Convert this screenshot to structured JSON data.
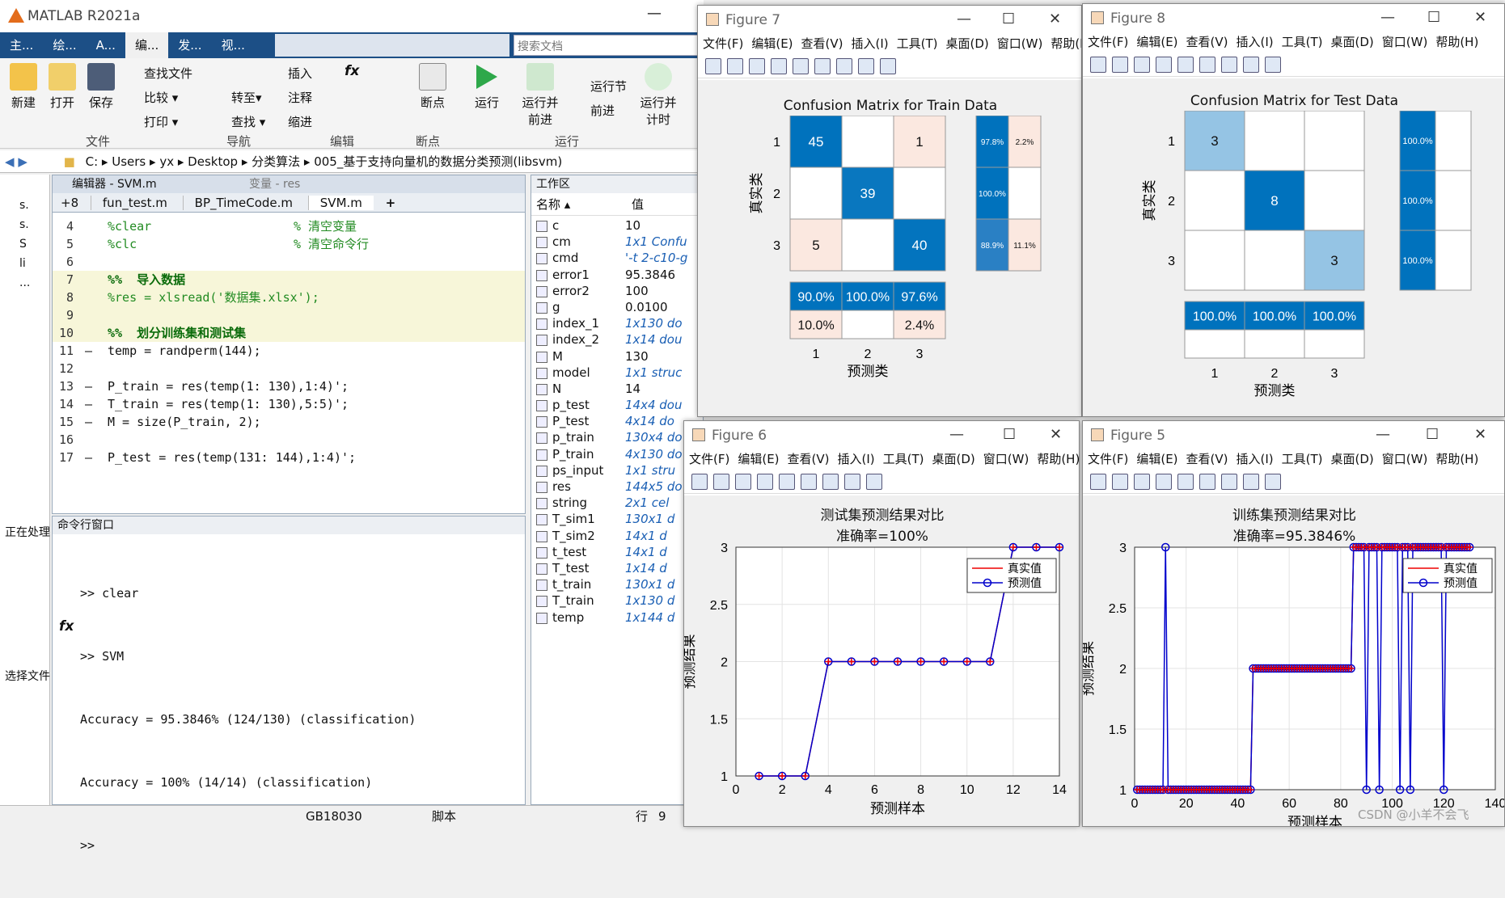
{
  "app": {
    "title": "MATLAB R2021a",
    "tabs": [
      "主...",
      "绘...",
      "A...",
      "编...",
      "发...",
      "视..."
    ],
    "search_placeholder": "搜索文档"
  },
  "ribbon": {
    "file_group": {
      "new": "新建",
      "open": "打开",
      "save": "保存",
      "find_files": "查找文件",
      "compare": "比较 ▾",
      "print": "打印 ▾",
      "label": "文件"
    },
    "nav_group": {
      "goto": "转至▾",
      "find": "查找 ▾",
      "label": "导航"
    },
    "edit_group": {
      "insert": "插入",
      "comment": "注释",
      "indent": "缩进",
      "fx": "fx",
      "label": "编辑"
    },
    "breakpoints": {
      "label": "断点",
      "btn": "断点"
    },
    "run_group": {
      "run": "运行",
      "run_advance": "运行并\n前进",
      "run_section": "运行节",
      "advance": "前进",
      "run_time": "运行并\n计时",
      "label": "运行"
    }
  },
  "breadcrumb": [
    "C:",
    "Users",
    "yx",
    "Desktop",
    "分类算法",
    "005_基于支持向量机的数据分类预测(libsvm)"
  ],
  "editor": {
    "title": "编辑器 - SVM.m",
    "var_title": "变量 - res",
    "tabs": [
      "+8",
      "fun_test.m",
      "BP_TimeCode.m",
      "SVM.m",
      "+"
    ],
    "lines": [
      {
        "n": "4",
        "dash": "",
        "code": "%clear",
        "comment": "% 清空变量",
        "type": "cm"
      },
      {
        "n": "5",
        "dash": "",
        "code": "%clc",
        "comment": "% 清空命令行",
        "type": "cm"
      },
      {
        "n": "6",
        "dash": "",
        "code": "",
        "comment": "",
        "type": "cm"
      },
      {
        "n": "7",
        "dash": "",
        "code": "%%  导入数据",
        "comment": "",
        "type": "sec"
      },
      {
        "n": "8",
        "dash": "",
        "code": "%res = xlsread('数据集.xlsx');",
        "comment": "",
        "type": "cm"
      },
      {
        "n": "9",
        "dash": "",
        "code": "",
        "comment": "",
        "type": "cm"
      },
      {
        "n": "10",
        "dash": "",
        "code": "%%  划分训练集和测试集",
        "comment": "",
        "type": "sec"
      },
      {
        "n": "11",
        "dash": "—",
        "code": "temp = randperm(144);",
        "comment": "",
        "type": "code"
      },
      {
        "n": "12",
        "dash": "",
        "code": "",
        "comment": "",
        "type": "code"
      },
      {
        "n": "13",
        "dash": "—",
        "code": "P_train = res(temp(1: 130),1:4)';",
        "comment": "",
        "type": "code"
      },
      {
        "n": "14",
        "dash": "—",
        "code": "T_train = res(temp(1: 130),5:5)';",
        "comment": "",
        "type": "code"
      },
      {
        "n": "15",
        "dash": "—",
        "code": "M = size(P_train, 2);",
        "comment": "",
        "type": "code"
      },
      {
        "n": "16",
        "dash": "",
        "code": "",
        "comment": "",
        "type": "code"
      },
      {
        "n": "17",
        "dash": "—",
        "code": "P_test = res(temp(131: 144),1:4)';",
        "comment": "",
        "type": "code"
      }
    ]
  },
  "left_panel": {
    "label1": "正在处理",
    "label2": "选择文件",
    "items": [
      "s.",
      "s.",
      "S",
      "li",
      "..."
    ]
  },
  "command_window": {
    "title": "命令行窗口",
    "lines": [
      ">> clear",
      ">> SVM",
      "Accuracy = 95.3846% (124/130) (classification)",
      "Accuracy = 100% (14/14) (classification)"
    ],
    "prompt": ">>",
    "fx": "fx"
  },
  "workspace": {
    "title": "工作区",
    "col_name": "名称 ▴",
    "col_value": "值",
    "rows": [
      [
        "c",
        "10"
      ],
      [
        "cm",
        "1x1 Confu"
      ],
      [
        "cmd",
        "'-t 2-c10-g"
      ],
      [
        "error1",
        "95.3846"
      ],
      [
        "error2",
        "100"
      ],
      [
        "g",
        "0.0100"
      ],
      [
        "index_1",
        "1x130 do"
      ],
      [
        "index_2",
        "1x14 dou"
      ],
      [
        "M",
        "130"
      ],
      [
        "model",
        "1x1 struc"
      ],
      [
        "N",
        "14"
      ],
      [
        "p_test",
        "14x4 dou"
      ],
      [
        "P_test",
        "4x14 do"
      ],
      [
        "p_train",
        "130x4 do"
      ],
      [
        "P_train",
        "4x130 do"
      ],
      [
        "ps_input",
        "1x1 stru"
      ],
      [
        "res",
        "144x5 do"
      ],
      [
        "string",
        "2x1 cel"
      ],
      [
        "T_sim1",
        "130x1 d"
      ],
      [
        "T_sim2",
        "14x1 d"
      ],
      [
        "t_test",
        "14x1 d"
      ],
      [
        "T_test",
        "1x14 d"
      ],
      [
        "t_train",
        "130x1 d"
      ],
      [
        "T_train",
        "1x130 d"
      ],
      [
        "temp",
        "1x144 d"
      ]
    ]
  },
  "status": {
    "encoding": "GB18030",
    "type": "脚本",
    "row_label": "行",
    "row": "9"
  },
  "figures": {
    "menu": [
      "文件(F)",
      "编辑(E)",
      "查看(V)",
      "插入(I)",
      "工具(T)",
      "桌面(D)",
      "窗口(W)",
      "帮助(H)"
    ],
    "fig7": {
      "title": "Figure 7",
      "chart_title": "Confusion Matrix for Train Data"
    },
    "fig8": {
      "title": "Figure 8",
      "chart_title": "Confusion Matrix for Test Data"
    },
    "fig6": {
      "title": "Figure 6",
      "title1": "测试集预测结果对比",
      "title2": "准确率=100%"
    },
    "fig5": {
      "title": "Figure 5",
      "title1": "训练集预测结果对比",
      "title2": "准确率=95.3846%"
    },
    "legend": {
      "true": "真实值",
      "pred": "预测值"
    },
    "xlabel_pred": "预测类",
    "ylabel_true": "真实类",
    "xlabel_sample": "预测样本",
    "ylabel_result": "预测结果"
  },
  "chart_data": [
    {
      "type": "heatmap",
      "title": "Confusion Matrix for Train Data",
      "xlabel": "预测类",
      "ylabel": "真实类",
      "categories": [
        "1",
        "2",
        "3"
      ],
      "matrix": [
        [
          45,
          0,
          1
        ],
        [
          0,
          39,
          0
        ],
        [
          5,
          0,
          40
        ]
      ],
      "row_summary": [
        [
          "97.8%",
          "2.2%"
        ],
        [
          "100.0%",
          ""
        ],
        [
          "88.9%",
          "11.1%"
        ]
      ],
      "col_summary": [
        [
          "90.0%",
          "100.0%",
          "97.6%"
        ],
        [
          "10.0%",
          "",
          "2.4%"
        ]
      ]
    },
    {
      "type": "heatmap",
      "title": "Confusion Matrix for Test Data",
      "xlabel": "预测类",
      "ylabel": "真实类",
      "categories": [
        "1",
        "2",
        "3"
      ],
      "matrix": [
        [
          3,
          0,
          0
        ],
        [
          0,
          8,
          0
        ],
        [
          0,
          0,
          3
        ]
      ],
      "row_summary": [
        [
          "100.0%",
          ""
        ],
        [
          "100.0%",
          ""
        ],
        [
          "100.0%",
          ""
        ]
      ],
      "col_summary": [
        [
          "100.0%",
          "100.0%",
          "100.0%"
        ],
        [
          "",
          "",
          ""
        ]
      ]
    },
    {
      "type": "line",
      "title": "测试集预测结果对比 准确率=100%",
      "xlabel": "预测样本",
      "ylabel": "预测结果",
      "xlim": [
        0,
        14
      ],
      "ylim": [
        1,
        3
      ],
      "xticks": [
        "0",
        "2",
        "4",
        "6",
        "8",
        "10",
        "12",
        "14"
      ],
      "yticks": [
        "1",
        "1.5",
        "2",
        "2.5",
        "3"
      ],
      "x": [
        1,
        2,
        3,
        4,
        5,
        6,
        7,
        8,
        9,
        10,
        11,
        12,
        13,
        14
      ],
      "series": [
        {
          "name": "真实值",
          "values": [
            1,
            1,
            1,
            2,
            2,
            2,
            2,
            2,
            2,
            2,
            2,
            3,
            3,
            3
          ]
        },
        {
          "name": "预测值",
          "values": [
            1,
            1,
            1,
            2,
            2,
            2,
            2,
            2,
            2,
            2,
            2,
            3,
            3,
            3
          ]
        }
      ]
    },
    {
      "type": "line",
      "title": "训练集预测结果对比 准确率=95.3846%",
      "xlabel": "预测样本",
      "ylabel": "预测结果",
      "xlim": [
        0,
        140
      ],
      "ylim": [
        1,
        3
      ],
      "xticks": [
        "0",
        "20",
        "40",
        "60",
        "80",
        "100",
        "120",
        "140"
      ],
      "yticks": [
        "1",
        "1.5",
        "2",
        "2.5",
        "3"
      ],
      "segments": [
        {
          "from": 1,
          "to": 45,
          "value": 1
        },
        {
          "from": 46,
          "to": 84,
          "value": 2
        },
        {
          "from": 85,
          "to": 130,
          "value": 3
        }
      ],
      "mismatches": [
        {
          "x": 12,
          "value": 3
        },
        {
          "x": 90,
          "value": 1
        },
        {
          "x": 95,
          "value": 1
        },
        {
          "x": 103,
          "value": 1
        },
        {
          "x": 107,
          "value": 1
        },
        {
          "x": 120,
          "value": 1
        }
      ],
      "series": [
        {
          "name": "真实值"
        },
        {
          "name": "预测值"
        }
      ]
    }
  ],
  "watermark": "CSDN @小羊不会飞"
}
